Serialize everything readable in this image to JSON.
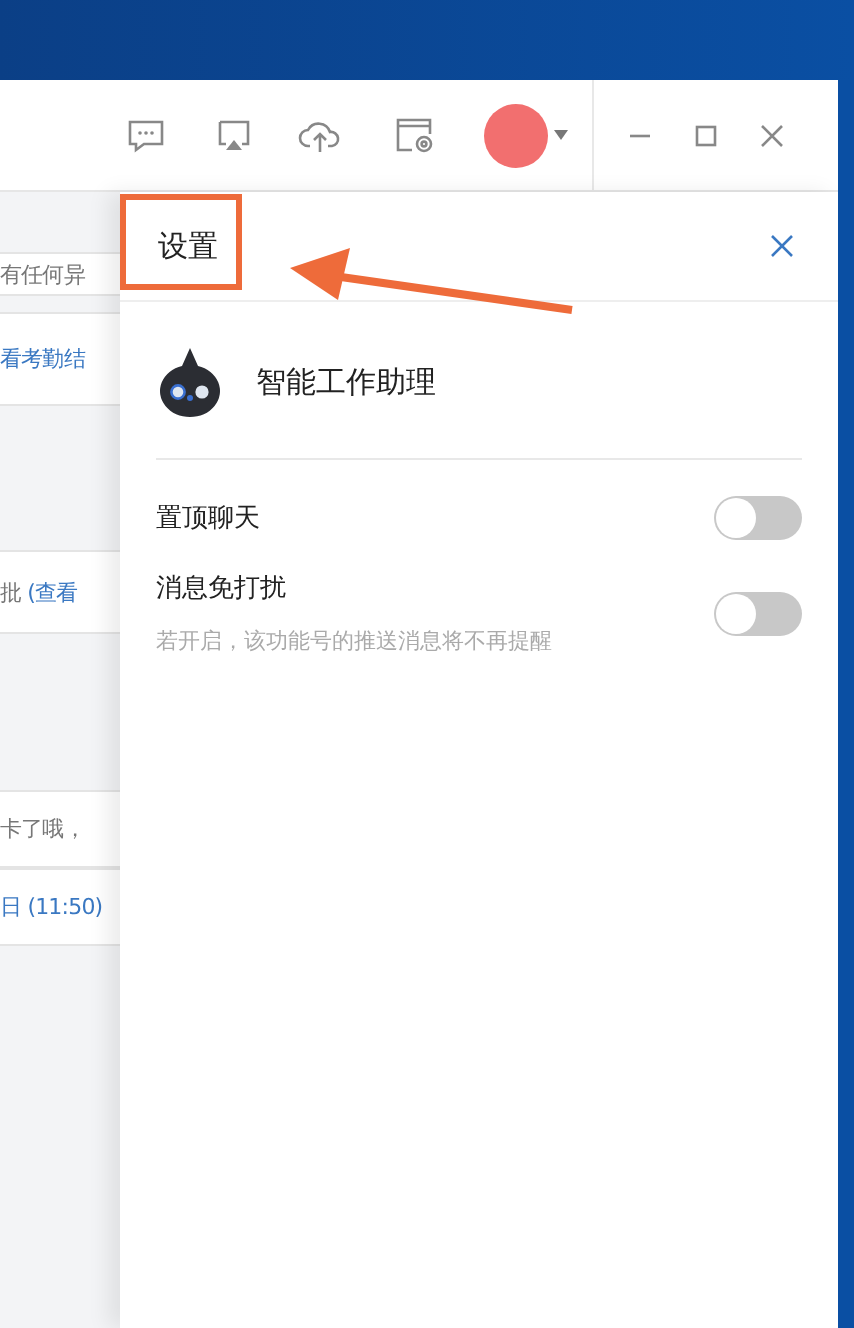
{
  "chat_rows": [
    {
      "segments": [
        {
          "text": "有任何异",
          "kind": "plain"
        }
      ]
    },
    {
      "segments": [
        {
          "text": "看考勤结",
          "kind": "link"
        }
      ]
    },
    {
      "segments": [
        {
          "text": "批",
          "kind": "plain"
        },
        {
          "text": "(查看",
          "kind": "link"
        }
      ]
    },
    {
      "segments": [
        {
          "text": "卡了哦，",
          "kind": "plain"
        }
      ]
    },
    {
      "segments": [
        {
          "text": "日 (11:50)",
          "kind": "link"
        }
      ]
    }
  ],
  "settings": {
    "title": "设置",
    "assistant": "智能工作助理",
    "options": [
      {
        "label": "置顶聊天",
        "on": false
      },
      {
        "label": "消息免打扰",
        "hint": "若开启，该功能号的推送消息将不再提醒",
        "on": false
      }
    ]
  }
}
